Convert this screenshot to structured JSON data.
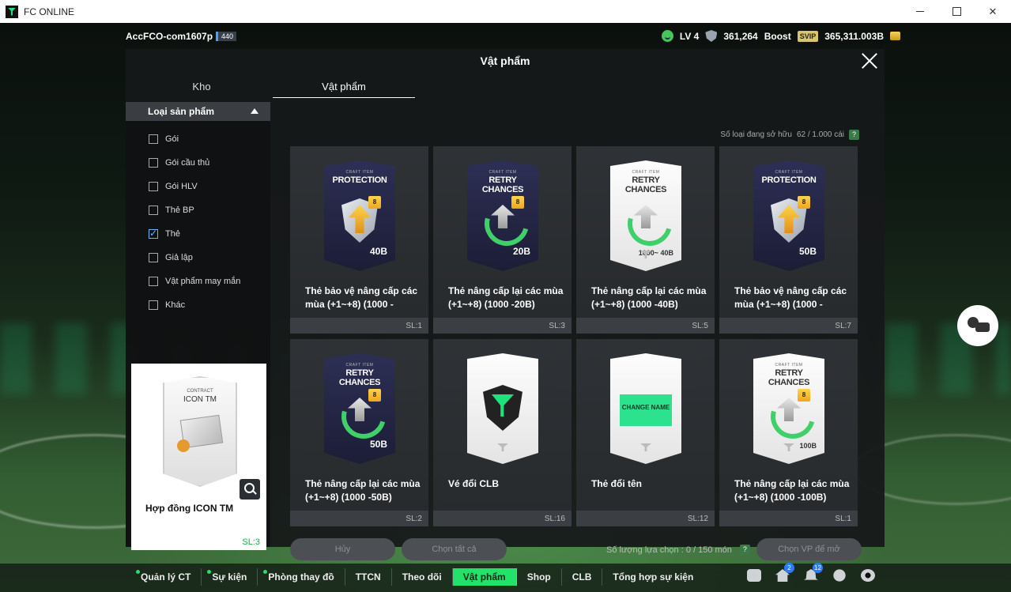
{
  "window": {
    "title": "FC ONLINE"
  },
  "top": {
    "account_name": "AccFCO-com1607p",
    "account_badge": "440",
    "level": "LV 4",
    "ovr": "361,264",
    "boost_label": "Boost",
    "svip_label": "SVIP",
    "currency": "365,311.003B"
  },
  "panel": {
    "title": "Vật phẩm",
    "tabs": [
      {
        "label": "Kho"
      },
      {
        "label": "Vật phẩm"
      }
    ],
    "filter": {
      "header": "Loại sản phẩm",
      "items": [
        {
          "label": "Gói",
          "checked": false
        },
        {
          "label": "Gói cầu thủ",
          "checked": false
        },
        {
          "label": "Gói HLV",
          "checked": false
        },
        {
          "label": "Thẻ BP",
          "checked": false
        },
        {
          "label": "Thẻ",
          "checked": true
        },
        {
          "label": "Giả lập",
          "checked": false
        },
        {
          "label": "Vật phẩm may mắn",
          "checked": false
        },
        {
          "label": "Khác",
          "checked": false
        }
      ]
    },
    "preview": {
      "card_sub": "CONTRACT",
      "card_title": "ICON TM",
      "name": "Hợp đồng ICON TM",
      "qty": "SL:3"
    },
    "owned_label": "Số loại đang sở hữu",
    "owned_value": "62 / 1.000 cái",
    "help": "?",
    "items": [
      {
        "card_style": "dark",
        "kind": "shield",
        "card_sub": "CRAFT ITEM",
        "card_title": "PROTECTION",
        "badge": "8",
        "price": "40B",
        "name_line1": "Thẻ bảo vệ nâng cấp các",
        "name_line2": "mùa (+1~+8) (1000 -",
        "qty": "SL:1"
      },
      {
        "card_style": "dark",
        "kind": "retry",
        "card_sub": "CRAFT ITEM",
        "card_title": "RETRY CHANCES",
        "badge": "8",
        "price": "20B",
        "name_line1": "Thẻ nâng cấp lại các mùa",
        "name_line2": "(+1~+8) (1000 -20B)",
        "qty": "SL:3"
      },
      {
        "card_style": "light",
        "kind": "retry",
        "card_sub": "CRAFT ITEM",
        "card_title": "RETRY CHANCES",
        "badge": "",
        "price": "1000~ 40B",
        "name_line1": "Thẻ nâng cấp lại các mùa",
        "name_line2": "(+1~+8) (1000 -40B)",
        "qty": "SL:5"
      },
      {
        "card_style": "dark",
        "kind": "shield",
        "card_sub": "CRAFT ITEM",
        "card_title": "PROTECTION",
        "badge": "8",
        "price": "50B",
        "name_line1": "Thẻ bảo vệ nâng cấp các",
        "name_line2": "mùa (+1~+8) (1000 -",
        "qty": "SL:7"
      },
      {
        "card_style": "dark",
        "kind": "retry",
        "card_sub": "CRAFT ITEM",
        "card_title": "RETRY CHANCES",
        "badge": "8",
        "price": "50B",
        "name_line1": "Thẻ nâng cấp lại các mùa",
        "name_line2": "(+1~+8) (1000 -50B)",
        "qty": "SL:2"
      },
      {
        "card_style": "light",
        "kind": "fc",
        "card_sub": "",
        "card_title": "",
        "badge": "",
        "price": "",
        "name_line1": "Vé đổi CLB",
        "name_line2": "",
        "qty": "SL:16"
      },
      {
        "card_style": "light",
        "kind": "name",
        "card_sub": "",
        "card_title": "",
        "badge": "",
        "price": "",
        "emblem_text": "CHANGE NAME",
        "name_line1": "Thẻ đổi tên",
        "name_line2": "",
        "qty": "SL:12"
      },
      {
        "card_style": "light",
        "kind": "retry",
        "card_sub": "CRAFT ITEM",
        "card_title": "RETRY CHANCES",
        "badge": "8",
        "price": "100B",
        "name_line1": "Thẻ nâng cấp lại các mùa",
        "name_line2": "(+1~+8) (1000 -100B)",
        "qty": "SL:1"
      }
    ],
    "actions": {
      "cancel": "Hủy",
      "select_all": "Chọn tất cả",
      "selection_label": "Số lượng lựa chọn : 0 / 150 món",
      "open": "Chọn VP để mở"
    }
  },
  "nav": {
    "items": [
      {
        "label": "Quản lý CT",
        "dot": true,
        "active": false
      },
      {
        "label": "Sự kiện",
        "dot": true,
        "active": false
      },
      {
        "label": "Phòng thay đồ",
        "dot": true,
        "active": false
      },
      {
        "label": "TTCN",
        "dot": false,
        "active": false
      },
      {
        "label": "Theo dõi",
        "dot": false,
        "active": false
      },
      {
        "label": "Vật phẩm",
        "dot": false,
        "active": true
      },
      {
        "label": "Shop",
        "dot": false,
        "active": false
      },
      {
        "label": "CLB",
        "dot": false,
        "active": false
      },
      {
        "label": "Tổng hợp sự kiện",
        "dot": false,
        "active": false
      }
    ],
    "icons": [
      {
        "name": "chat-icon",
        "badge": ""
      },
      {
        "name": "home-icon",
        "badge": "2"
      },
      {
        "name": "bell-icon",
        "badge": "12"
      },
      {
        "name": "user-icon",
        "badge": ""
      },
      {
        "name": "gear-icon",
        "badge": ""
      }
    ]
  }
}
